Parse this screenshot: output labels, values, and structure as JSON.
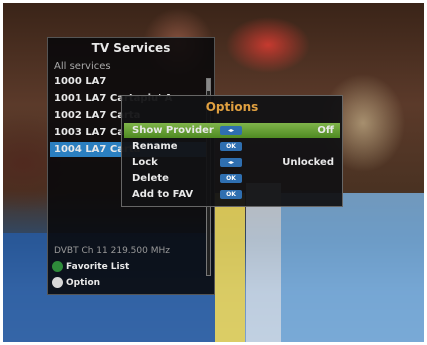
{
  "services_panel": {
    "title": "TV Services",
    "subtitle": "All services",
    "items": [
      {
        "label": "1000 LA7"
      },
      {
        "label": "1001 LA7 Cartapiu' A"
      },
      {
        "label": "1002 LA7 Carta"
      },
      {
        "label": "1003 LA7 Carta"
      },
      {
        "label": "1004 LA7 Carta"
      }
    ],
    "selected_index": 4,
    "frequency": "DVBT Ch 11 219.500 MHz",
    "legend": [
      {
        "label": "Favorite List",
        "color": "#2e8b3a"
      },
      {
        "label": "Option",
        "color": "#d8d8d8"
      }
    ]
  },
  "options_menu": {
    "title": "Options",
    "items": [
      {
        "label": "Show Provider",
        "key": "◂▸",
        "value": "Off"
      },
      {
        "label": "Rename",
        "key": "OK",
        "value": ""
      },
      {
        "label": "Lock",
        "key": "◂▸",
        "value": "Unlocked"
      },
      {
        "label": "Delete",
        "key": "OK",
        "value": ""
      },
      {
        "label": "Add to FAV",
        "key": "OK",
        "value": ""
      }
    ],
    "selected_index": 0
  },
  "colors": {
    "selected_service": "#2b7fc0",
    "selected_option": "#5f9a2e",
    "options_title": "#e0a040"
  }
}
